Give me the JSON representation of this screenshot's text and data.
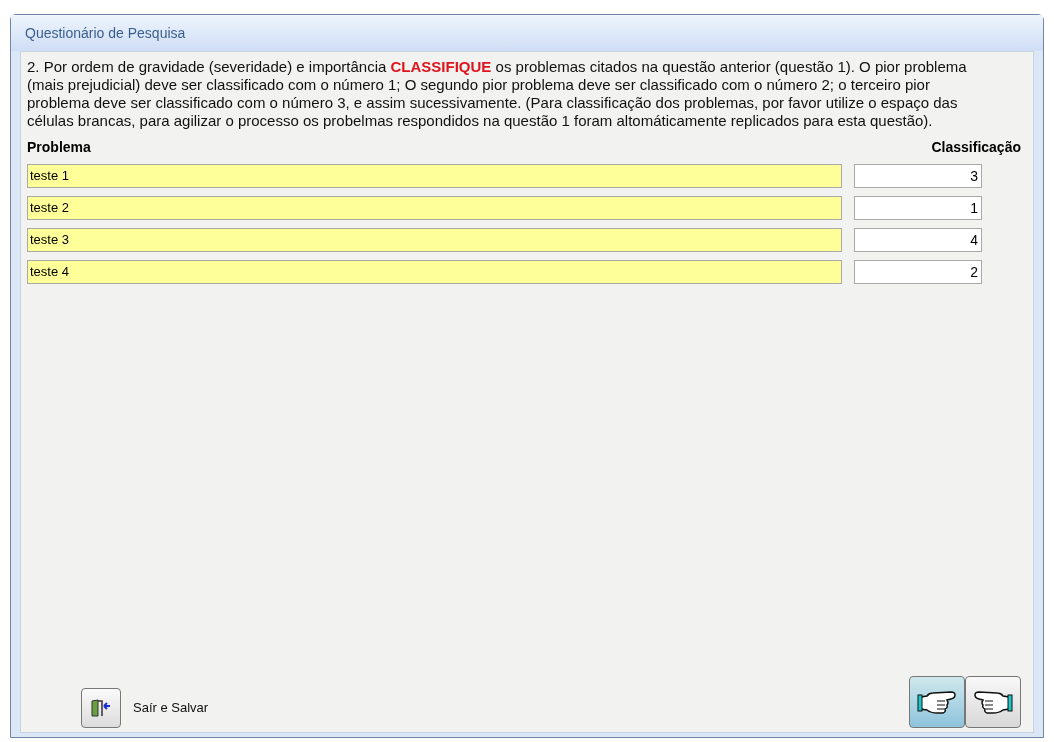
{
  "window": {
    "title": "Questionário de Pesquisa"
  },
  "question": "2. Por ordem de gravidade (severidade) e importância **CLASSIFIQUE** os problemas citados na questão anterior (questão 1). O pior problema (mais prejudicial) deve ser classificado com o número 1; O segundo pior problema deve ser classificado com o número 2; o terceiro pior problema deve ser classificado com o número 3, e assim sucessivamente. (Para classificação dos problemas, por favor utilize o espaço das células brancas, para agilizar o processo os probelmas respondidos na questão 1 foram altomáticamente replicados para esta questão).",
  "table": {
    "columns": [
      "Problema",
      "Classificação"
    ],
    "rows": [
      {
        "problem": "teste 1",
        "rank": "3"
      },
      {
        "problem": "teste 2",
        "rank": "1"
      },
      {
        "problem": "teste 3",
        "rank": "4"
      },
      {
        "problem": "teste 4",
        "rank": "2"
      }
    ]
  },
  "exit_button": {
    "label": "Saír e Salvar"
  },
  "nav_buttons": [
    {
      "kind": "back",
      "selected": true
    },
    {
      "kind": "next",
      "selected": false
    }
  ]
}
